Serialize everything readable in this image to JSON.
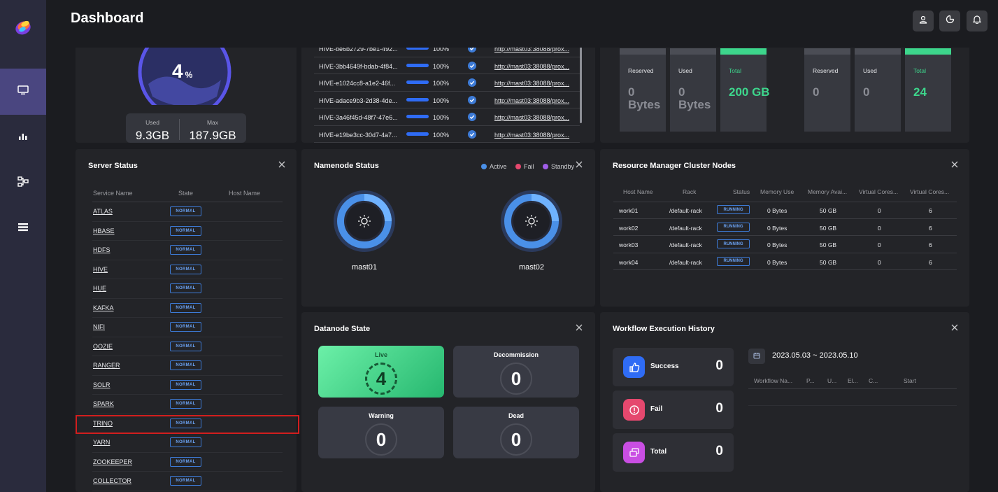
{
  "header": {
    "title": "Dashboard"
  },
  "sidebar": {
    "items": [
      "monitor-icon",
      "chart-icon",
      "workflow-icon",
      "list-icon"
    ]
  },
  "memory": {
    "percent": "4",
    "percent_unit": "%",
    "used_label": "Used",
    "used_value": "9.3GB",
    "max_label": "Max",
    "max_value": "187.9GB"
  },
  "hive_jobs": {
    "rows": [
      {
        "id": "HIVE-be6b2729-7be1-492...",
        "pct": "100%",
        "link": "http://mast03:38088/prox..."
      },
      {
        "id": "HIVE-3bb4649f-bdab-4f84...",
        "pct": "100%",
        "link": "http://mast03:38088/prox..."
      },
      {
        "id": "HIVE-e1024cc8-a1e2-46f...",
        "pct": "100%",
        "link": "http://mast03:38088/prox..."
      },
      {
        "id": "HIVE-adace9b3-2d38-4de...",
        "pct": "100%",
        "link": "http://mast03:38088/prox..."
      },
      {
        "id": "HIVE-3a46f45d-48f7-47e6...",
        "pct": "100%",
        "link": "http://mast03:38088/prox..."
      },
      {
        "id": "HIVE-e19be3cc-30d7-4a7...",
        "pct": "100%",
        "link": "http://mast03:38088/prox..."
      }
    ]
  },
  "resources": {
    "group1": [
      {
        "label": "Reserved",
        "value": "0 Bytes"
      },
      {
        "label": "Used",
        "value": "0 Bytes"
      },
      {
        "label": "Total",
        "value": "200 GB"
      }
    ],
    "group2": [
      {
        "label": "Reserved",
        "value": "0"
      },
      {
        "label": "Used",
        "value": "0"
      },
      {
        "label": "Total",
        "value": "24"
      }
    ]
  },
  "server_status": {
    "title": "Server Status",
    "columns": [
      "Service Name",
      "State",
      "Host Name"
    ],
    "rows": [
      {
        "name": "ATLAS",
        "state": "NORMAL"
      },
      {
        "name": "HBASE",
        "state": "NORMAL"
      },
      {
        "name": "HDFS",
        "state": "NORMAL"
      },
      {
        "name": "HIVE",
        "state": "NORMAL"
      },
      {
        "name": "HUE",
        "state": "NORMAL"
      },
      {
        "name": "KAFKA",
        "state": "NORMAL"
      },
      {
        "name": "NIFI",
        "state": "NORMAL"
      },
      {
        "name": "OOZIE",
        "state": "NORMAL"
      },
      {
        "name": "RANGER",
        "state": "NORMAL"
      },
      {
        "name": "SOLR",
        "state": "NORMAL"
      },
      {
        "name": "SPARK",
        "state": "NORMAL"
      },
      {
        "name": "TRINO",
        "state": "NORMAL"
      },
      {
        "name": "YARN",
        "state": "NORMAL"
      },
      {
        "name": "ZOOKEEPER",
        "state": "NORMAL"
      },
      {
        "name": "COLLECTOR",
        "state": "NORMAL"
      }
    ]
  },
  "namenode": {
    "title": "Namenode Status",
    "legend": [
      "Active",
      "Fail",
      "Standby"
    ],
    "nodes": [
      "mast01",
      "mast02"
    ]
  },
  "rm_nodes": {
    "title": "Resource Manager Cluster Nodes",
    "columns": [
      "Host Name",
      "Rack",
      "Status",
      "Memory Use",
      "Memory Avai...",
      "Virtual Cores...",
      "Virtual Cores..."
    ],
    "rows": [
      {
        "host": "work01",
        "rack": "/default-rack",
        "status": "RUNNING",
        "mem_use": "0 Bytes",
        "mem_avail": "50 GB",
        "vc_used": "0",
        "vc_total": "6"
      },
      {
        "host": "work02",
        "rack": "/default-rack",
        "status": "RUNNING",
        "mem_use": "0 Bytes",
        "mem_avail": "50 GB",
        "vc_used": "0",
        "vc_total": "6"
      },
      {
        "host": "work03",
        "rack": "/default-rack",
        "status": "RUNNING",
        "mem_use": "0 Bytes",
        "mem_avail": "50 GB",
        "vc_used": "0",
        "vc_total": "6"
      },
      {
        "host": "work04",
        "rack": "/default-rack",
        "status": "RUNNING",
        "mem_use": "0 Bytes",
        "mem_avail": "50 GB",
        "vc_used": "0",
        "vc_total": "6"
      }
    ]
  },
  "datanode": {
    "title": "Datanode State",
    "cards": [
      {
        "label": "Live",
        "value": "4"
      },
      {
        "label": "Decommission",
        "value": "0"
      },
      {
        "label": "Warning",
        "value": "0"
      },
      {
        "label": "Dead",
        "value": "0"
      }
    ]
  },
  "workflow": {
    "title": "Workflow Execution History",
    "date_range": "2023.05.03 ~ 2023.05.10",
    "cards": [
      {
        "label": "Success",
        "value": "0",
        "color": "#2f6cf5"
      },
      {
        "label": "Fail",
        "value": "0",
        "color": "#e5486e"
      },
      {
        "label": "Total",
        "value": "0",
        "color": "#c94ee3"
      }
    ],
    "columns": [
      "Workflow Na...",
      "P...",
      "U...",
      "El...",
      "C...",
      "Start"
    ]
  },
  "colors": {
    "accent": "#3d7bd7",
    "green": "#3dd68c",
    "highlight": "#d21e1e"
  }
}
